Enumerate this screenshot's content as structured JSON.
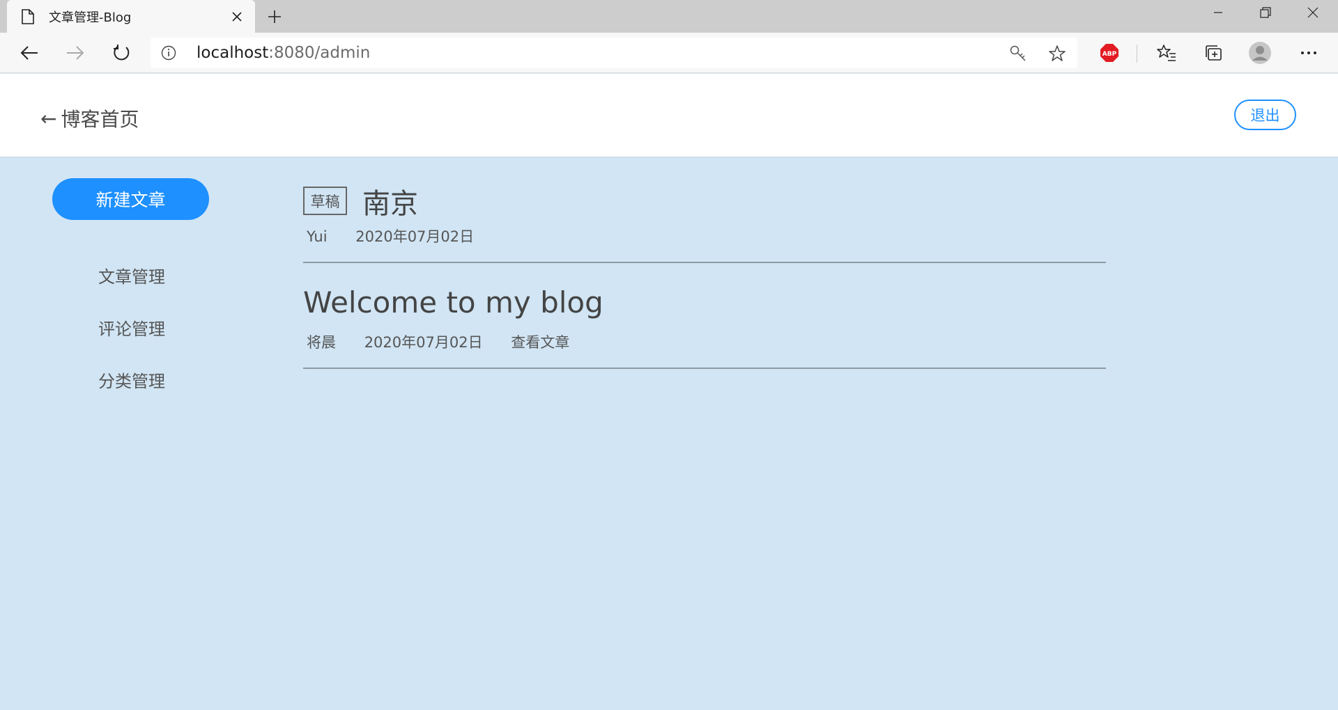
{
  "browser": {
    "tab_title": "文章管理-Blog",
    "url_host": "localhost",
    "url_rest": ":8080/admin"
  },
  "header": {
    "home_arrow": "←",
    "home_label": "博客首页",
    "logout_label": "退出"
  },
  "sidebar": {
    "new_post_label": "新建文章",
    "items": [
      {
        "label": "文章管理"
      },
      {
        "label": "评论管理"
      },
      {
        "label": "分类管理"
      }
    ]
  },
  "posts": [
    {
      "badge": "草稿",
      "title": "南京",
      "author": "Yui",
      "date": "2020年07月02日"
    },
    {
      "title": "Welcome to my blog",
      "author": "将晨",
      "date": "2020年07月02日",
      "view_label": "查看文章"
    }
  ],
  "colors": {
    "accent": "#1e90ff",
    "page_background": "#d1e5f4",
    "abp_red": "#e31b23"
  },
  "icons": [
    "page-icon",
    "close-icon",
    "plus-icon",
    "minimize-icon",
    "restore-icon",
    "back-arrow-icon",
    "forward-arrow-icon",
    "refresh-icon",
    "info-icon",
    "key-icon",
    "star-icon",
    "adblock-icon",
    "favorites-icon",
    "collections-icon",
    "profile-icon",
    "more-icon"
  ]
}
